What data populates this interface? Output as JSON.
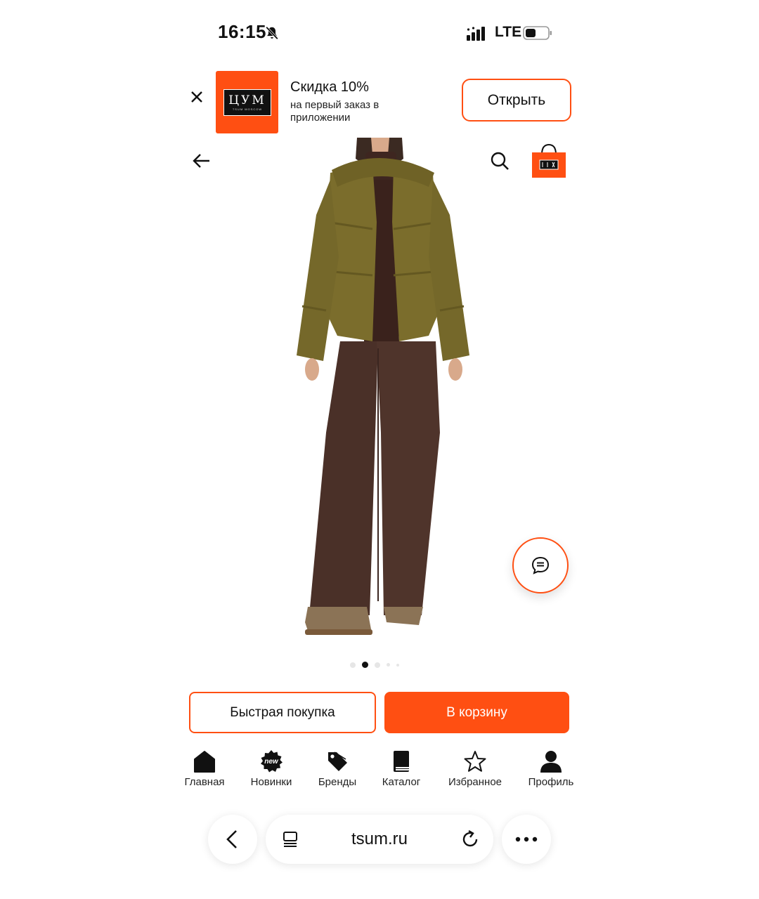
{
  "status_bar": {
    "time": "16:15",
    "network": "LTE",
    "icons": [
      "bell-muted-icon",
      "signal-icon",
      "battery-icon"
    ]
  },
  "app_banner": {
    "logo_text": "ЦУМ",
    "logo_subtext": "TSUM MOSCOW",
    "title": "Скидка 10%",
    "subtitle": "на первый заказ в приложении",
    "open_label": "Открыть",
    "accent_color": "#ff4f12"
  },
  "product": {
    "image_alt": "model-in-olive-puffer-jacket",
    "gallery_active_index": 1,
    "gallery_count": 5
  },
  "actions": {
    "quick_buy_label": "Быстрая покупка",
    "add_to_cart_label": "В корзину"
  },
  "bottom_nav": {
    "items": [
      {
        "label": "Главная",
        "icon": "home-icon"
      },
      {
        "label": "Новинки",
        "icon": "new-badge-icon",
        "badge": "new"
      },
      {
        "label": "Бренды",
        "icon": "tag-icon"
      },
      {
        "label": "Каталог",
        "icon": "book-icon"
      },
      {
        "label": "Избранное",
        "icon": "star-icon"
      },
      {
        "label": "Профиль",
        "icon": "user-icon"
      }
    ]
  },
  "browser": {
    "url": "tsum.ru"
  }
}
